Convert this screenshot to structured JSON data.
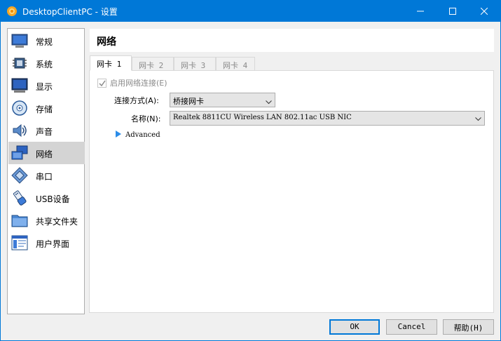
{
  "window": {
    "title": "DesktopClientPC - 设置",
    "minimize_icon": "minimize-icon",
    "maximize_icon": "maximize-icon",
    "close_icon": "close-icon",
    "accent_color": "#0078d7"
  },
  "sidebar": {
    "items": [
      {
        "label": "常规",
        "icon": "general-icon",
        "selected": false
      },
      {
        "label": "系统",
        "icon": "system-chip-icon",
        "selected": false
      },
      {
        "label": "显示",
        "icon": "display-monitor-icon",
        "selected": false
      },
      {
        "label": "存储",
        "icon": "storage-disc-icon",
        "selected": false
      },
      {
        "label": "声音",
        "icon": "audio-speaker-icon",
        "selected": false
      },
      {
        "label": "网络",
        "icon": "network-icon",
        "selected": true
      },
      {
        "label": "串口",
        "icon": "serial-port-icon",
        "selected": false
      },
      {
        "label": "USB设备",
        "icon": "usb-icon",
        "selected": false
      },
      {
        "label": "共享文件夹",
        "icon": "shared-folder-icon",
        "selected": false
      },
      {
        "label": "用户界面",
        "icon": "user-interface-icon",
        "selected": false
      }
    ]
  },
  "page": {
    "title": "网络"
  },
  "tabs": [
    {
      "label": "网卡 1",
      "active": true
    },
    {
      "label": "网卡 2",
      "active": false
    },
    {
      "label": "网卡 3",
      "active": false
    },
    {
      "label": "网卡 4",
      "active": false
    }
  ],
  "adapter": {
    "enable_label": "启用网络连接(E)",
    "enable_checked": true,
    "attached_label": "连接方式(A):",
    "attached_value": "桥接网卡",
    "name_label": "名称(N):",
    "name_value": "Realtek 8811CU Wireless LAN 802.11ac USB NIC",
    "advanced_label": "Advanced"
  },
  "buttons": {
    "ok": "OK",
    "cancel": "Cancel",
    "help": "帮助(H)"
  }
}
